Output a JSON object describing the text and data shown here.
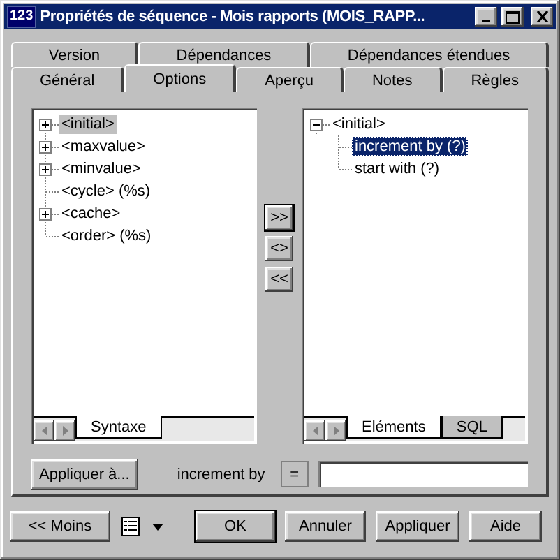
{
  "window": {
    "icon_text": "123",
    "title": "Propriétés de séquence - Mois rapports (MOIS_RAPP..."
  },
  "tab_rows": [
    {
      "tabs": [
        {
          "label": "Version",
          "selected": false
        },
        {
          "label": "Dépendances",
          "selected": false
        },
        {
          "label": "Dépendances étendues",
          "selected": false
        }
      ]
    },
    {
      "tabs": [
        {
          "label": "Général",
          "selected": false
        },
        {
          "label": "Options",
          "selected": true
        },
        {
          "label": "Aperçu",
          "selected": false
        },
        {
          "label": "Notes",
          "selected": false
        },
        {
          "label": "Règles",
          "selected": false
        }
      ]
    }
  ],
  "syntax_tree": {
    "items": [
      {
        "kind": "node",
        "label": "<initial>",
        "expanded": false,
        "selected": true
      },
      {
        "kind": "node",
        "label": "<maxvalue>",
        "expanded": false,
        "selected": false
      },
      {
        "kind": "node",
        "label": "<minvalue>",
        "expanded": false,
        "selected": false
      },
      {
        "kind": "leaf",
        "label": "<cycle> (%s)",
        "selected": false
      },
      {
        "kind": "node",
        "label": "<cache>",
        "expanded": false,
        "selected": false
      },
      {
        "kind": "leaf",
        "label": "<order> (%s)",
        "selected": false
      }
    ],
    "tabs": [
      {
        "label": "Syntaxe",
        "selected": true
      }
    ]
  },
  "transfer_buttons": [
    {
      "label": ">>",
      "default": true
    },
    {
      "label": "<>",
      "default": false
    },
    {
      "label": "<<",
      "default": false
    }
  ],
  "elements_tree": {
    "items": [
      {
        "kind": "node",
        "label": "<initial>",
        "expanded": true,
        "selected": false,
        "children": [
          {
            "kind": "leaf",
            "label": "increment by (?)",
            "selected": true
          },
          {
            "kind": "leaf",
            "label": "start with (?)",
            "selected": false
          }
        ]
      }
    ],
    "tabs": [
      {
        "label": "Eléments",
        "selected": true
      },
      {
        "label": "SQL",
        "selected": false
      }
    ]
  },
  "apply_to_button": "Appliquer à...",
  "field_label": "increment by",
  "operator": "=",
  "buttons": [
    {
      "label": "<< Moins",
      "default": false
    },
    {
      "label": "OK",
      "default": true
    },
    {
      "label": "Annuler",
      "default": false
    },
    {
      "label": "Appliquer",
      "default": false
    },
    {
      "label": "Aide",
      "default": false
    }
  ]
}
